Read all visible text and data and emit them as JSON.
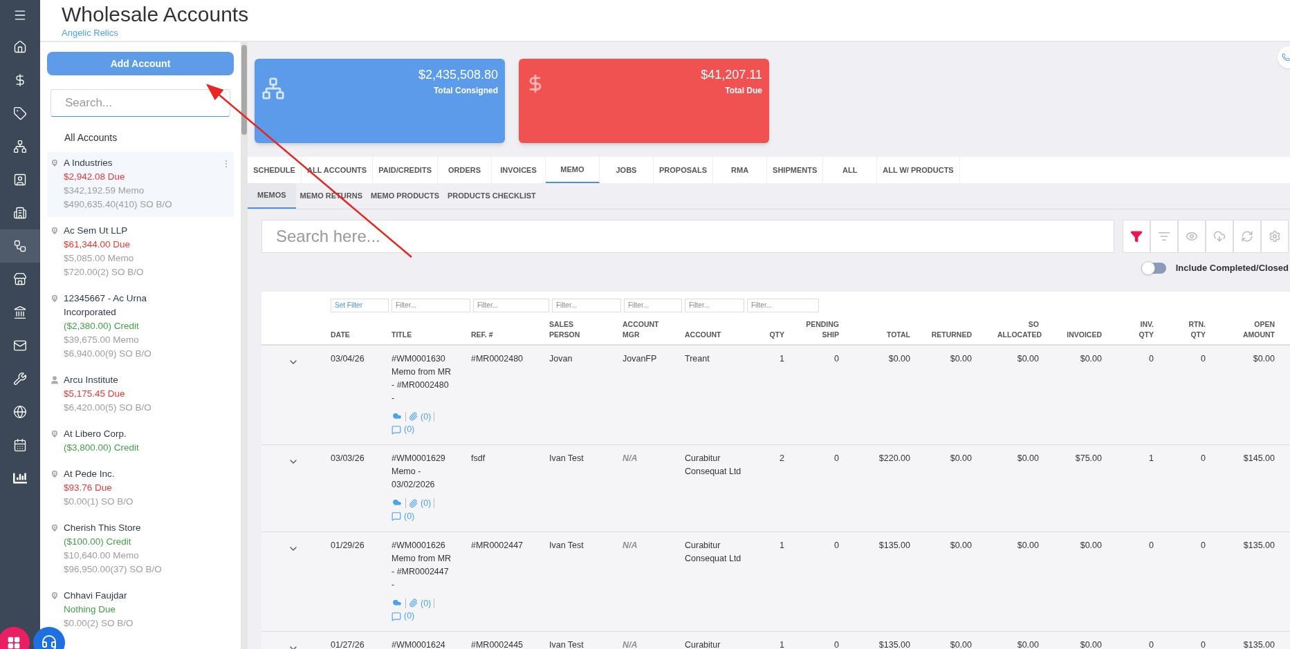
{
  "nav_items": [
    {
      "selected": false
    },
    {
      "selected": false
    },
    {
      "selected": false
    },
    {
      "selected": false
    },
    {
      "selected": false
    },
    {
      "selected": false
    },
    {
      "selected": false
    },
    {
      "selected": true
    },
    {
      "selected": false
    },
    {
      "selected": false
    },
    {
      "selected": false
    },
    {
      "selected": false
    },
    {
      "selected": false
    },
    {
      "selected": false
    },
    {
      "selected": false
    }
  ],
  "header": {
    "title": "Wholesale Accounts",
    "subtitle": "Angelic Relics"
  },
  "accounts_panel": {
    "add_button": "Add Account",
    "search": {
      "placeholder": "Search..."
    },
    "all_label": "All Accounts",
    "accounts": [
      {
        "name": "A Industries",
        "kind": "location",
        "selected": true,
        "lines": [
          {
            "text": "$2,942.08 Due",
            "kind": "due"
          },
          {
            "text": "$342,192.59 Memo",
            "kind": "muted"
          },
          {
            "text": "$490,635.40(410) SO B/O",
            "kind": "muted"
          }
        ]
      },
      {
        "name": "Ac Sem Ut LLP",
        "kind": "location",
        "selected": false,
        "lines": [
          {
            "text": "$61,344.00 Due",
            "kind": "due"
          },
          {
            "text": "$5,085.00 Memo",
            "kind": "muted"
          },
          {
            "text": "$720.00(2) SO B/O",
            "kind": "muted"
          }
        ]
      },
      {
        "name": "12345667 - Ac Urna Incorporated",
        "kind": "location",
        "selected": false,
        "lines": [
          {
            "text": "($2,380.00) Credit",
            "kind": "credit"
          },
          {
            "text": "$39,675.00 Memo",
            "kind": "muted"
          },
          {
            "text": "$6,940.00(9) SO B/O",
            "kind": "muted"
          }
        ]
      },
      {
        "name": "Arcu Institute",
        "kind": "person",
        "selected": false,
        "lines": [
          {
            "text": "$5,175.45 Due",
            "kind": "due"
          },
          {
            "text": "$6,420.00(5) SO B/O",
            "kind": "muted"
          }
        ]
      },
      {
        "name": "At Libero Corp.",
        "kind": "location",
        "selected": false,
        "lines": [
          {
            "text": "($3,800.00) Credit",
            "kind": "credit"
          }
        ]
      },
      {
        "name": "At Pede Inc.",
        "kind": "location",
        "selected": false,
        "lines": [
          {
            "text": "$93.76 Due",
            "kind": "due"
          },
          {
            "text": "$0.00(1) SO B/O",
            "kind": "muted"
          }
        ]
      },
      {
        "name": "Cherish This Store",
        "kind": "location",
        "selected": false,
        "lines": [
          {
            "text": "($100.00) Credit",
            "kind": "credit"
          },
          {
            "text": "$10,640.00 Memo",
            "kind": "muted"
          },
          {
            "text": "$96,950.00(37) SO B/O",
            "kind": "muted"
          }
        ]
      },
      {
        "name": "Chhavi Faujdar",
        "kind": "location",
        "selected": false,
        "lines": [
          {
            "text": "Nothing Due",
            "kind": "credit"
          },
          {
            "text": "$0.00(2) SO B/O",
            "kind": "muted"
          }
        ]
      }
    ]
  },
  "stat_cards": [
    {
      "kind": "consigned",
      "value": "$2,435,508.80",
      "label": "Total Consigned"
    },
    {
      "kind": "due",
      "value": "$41,207.11",
      "label": "Total Due"
    }
  ],
  "tabs": [
    {
      "label": "SCHEDULE",
      "selected": false
    },
    {
      "label": "ALL ACCOUNTS",
      "selected": false
    },
    {
      "label": "PAID/CREDITS",
      "selected": false
    },
    {
      "label": "ORDERS",
      "selected": false
    },
    {
      "label": "INVOICES",
      "selected": false
    },
    {
      "label": "MEMO",
      "selected": true
    },
    {
      "label": "JOBS",
      "selected": false
    },
    {
      "label": "PROPOSALS",
      "selected": false
    },
    {
      "label": "RMA",
      "selected": false
    },
    {
      "label": "SHIPMENTS",
      "selected": false
    },
    {
      "label": "ALL",
      "selected": false
    },
    {
      "label": "ALL W/ PRODUCTS",
      "selected": false
    }
  ],
  "subtabs": [
    {
      "label": "MEMOS",
      "selected": true
    },
    {
      "label": "MEMO RETURNS",
      "selected": false
    },
    {
      "label": "MEMO PRODUCTS",
      "selected": false
    },
    {
      "label": "PRODUCTS CHECKLIST",
      "selected": false
    }
  ],
  "search": {
    "placeholder": "Search here..."
  },
  "toolbar": [
    {
      "kind": "filter",
      "active": true
    },
    {
      "kind": "sort",
      "active": false
    },
    {
      "kind": "view",
      "active": false
    },
    {
      "kind": "download",
      "active": false
    },
    {
      "kind": "refresh",
      "active": false
    },
    {
      "kind": "settings",
      "active": false
    }
  ],
  "include_completed": {
    "label": "Include Completed/Closed",
    "on": false
  },
  "table": {
    "set_filter": "Set Filter",
    "filters": [
      {
        "placeholder": "Filter..."
      },
      {
        "placeholder": "Filter..."
      },
      {
        "placeholder": "Filter..."
      },
      {
        "placeholder": "Filter..."
      },
      {
        "placeholder": "Filter..."
      },
      {
        "placeholder": "Filter..."
      }
    ],
    "columns": [
      "DATE",
      "TITLE",
      "REF. #",
      "SALES PERSON",
      "ACCOUNT MGR",
      "ACCOUNT",
      "QTY",
      "PENDING SHIP",
      "TOTAL",
      "RETURNED",
      "SO ALLOCATED",
      "INVOICED",
      "INV. QTY",
      "RTN. QTY",
      "OPEN AMOUNT"
    ],
    "rows": [
      {
        "cells": [
          "03/04/26",
          "#WM0001630 Memo from MR - #MR0002480 -",
          "#MR0002480",
          "Jovan",
          "JovanFP",
          "Treant",
          "1",
          "0",
          "$0.00",
          "$0.00",
          "$0.00",
          "$0.00",
          "0",
          "0",
          "$0.00"
        ],
        "mgr_missing": false,
        "attachments": "(0)",
        "comments": "(0)"
      },
      {
        "cells": [
          "03/03/26",
          "#WM0001629 Memo - 03/02/2026",
          "fsdf",
          "Ivan Test",
          "N/A",
          "Curabitur Consequat Ltd",
          "2",
          "0",
          "$220.00",
          "$0.00",
          "$0.00",
          "$75.00",
          "1",
          "0",
          "$145.00"
        ],
        "mgr_missing": true,
        "attachments": "(0)",
        "comments": "(0)"
      },
      {
        "cells": [
          "01/29/26",
          "#WM0001626 Memo from MR - #MR0002447 -",
          "#MR0002447",
          "Ivan Test",
          "N/A",
          "Curabitur Consequat Ltd",
          "1",
          "0",
          "$135.00",
          "$0.00",
          "$0.00",
          "$0.00",
          "0",
          "0",
          "$135.00"
        ],
        "mgr_missing": true,
        "attachments": "(0)",
        "comments": "(0)"
      },
      {
        "cells": [
          "01/27/26",
          "#WM0001624",
          "#MR0002445",
          "Ivan Test",
          "N/A",
          "Curabitur",
          "1",
          "0",
          "$135.00",
          "$0.00",
          "$0.00",
          "$0.00",
          "0",
          "0",
          "$135.00"
        ],
        "mgr_missing": true
      }
    ]
  }
}
